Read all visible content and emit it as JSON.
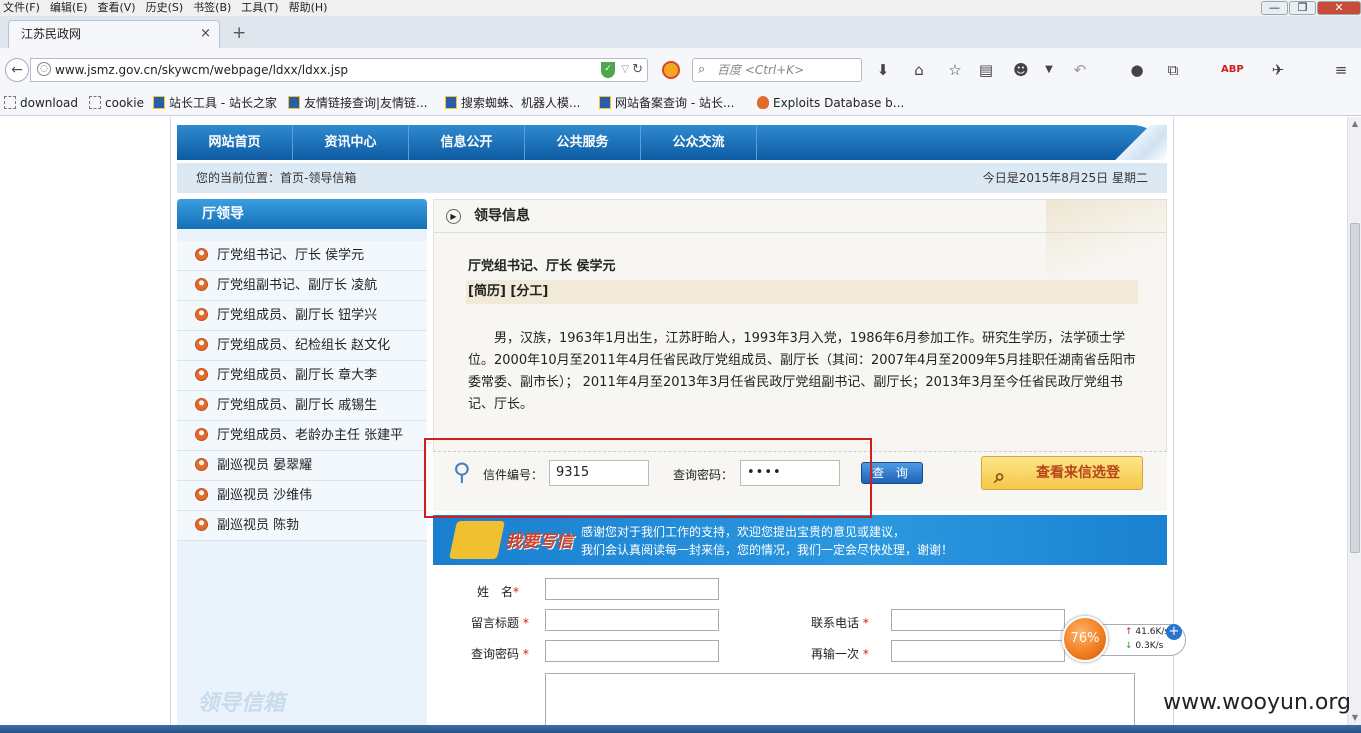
{
  "menubar": {
    "items": [
      "文件(F)",
      "编辑(E)",
      "查看(V)",
      "历史(S)",
      "书签(B)",
      "工具(T)",
      "帮助(H)"
    ]
  },
  "tab": {
    "title": "江苏民政网",
    "close": "×",
    "new": "+"
  },
  "address_bar": {
    "url": "www.jsmz.gov.cn/skywcm/webpage/ldxx/ldxx.jsp"
  },
  "search_box": {
    "placeholder": "百度 <Ctrl+K>"
  },
  "bookmarks": [
    {
      "label": "download",
      "icon": "folder-icon"
    },
    {
      "label": "cookie",
      "icon": "folder-icon"
    },
    {
      "label": "站长工具 - 站长之家",
      "icon": "page-icon"
    },
    {
      "label": "友情链接查询|友情链...",
      "icon": "page-icon"
    },
    {
      "label": "搜索蜘蛛、机器人模...",
      "icon": "page-icon"
    },
    {
      "label": "网站备案查询 - 站长...",
      "icon": "page-icon"
    },
    {
      "label": "Exploits Database b...",
      "icon": "bug-icon"
    }
  ],
  "site_nav": [
    "网站首页",
    "资讯中心",
    "信息公开",
    "公共服务",
    "公众交流"
  ],
  "breadcrumb": "您的当前位置：首页-领导信箱",
  "today": "今日是2015年8月25日 星期二",
  "sidebar": {
    "title": "厅领导",
    "items": [
      "厅党组书记、厅长 侯学元",
      "厅党组副书记、副厅长 凌航",
      "厅党组成员、副厅长 钮学兴",
      "厅党组成员、纪检组长 赵文化",
      "厅党组成员、副厅长 章大李",
      "厅党组成员、副厅长 戚锡生",
      "厅党组成员、老龄办主任 张建平",
      "副巡视员 晏翠耀",
      "副巡视员 沙维伟",
      "副巡视员 陈勃"
    ],
    "watermark": "领导信箱"
  },
  "main": {
    "heading": "领导信息",
    "leader_name": "厅党组书记、厅长 侯学元",
    "tabs": "[简历] [分工]",
    "bio": "男，汉族，1963年1月出生，江苏盱眙人，1993年3月入党，1986年6月参加工作。研究生学历，法学硕士学位。2000年10月至2011年4月任省民政厅党组成员、副厅长（其间：2007年4月至2009年5月挂职任湖南省岳阳市委常委、副市长）； 2011年4月至2013年3月任省民政厅党组副书记、副厅长；2013年3月至今任省民政厅党组书记、厅长。"
  },
  "query": {
    "letter_no_label": "信件编号：",
    "letter_no_value": "9315",
    "password_label": "查询密码：",
    "password_value": "••••",
    "query_button": "查 询",
    "view_button": "查看来信选登"
  },
  "write_banner": {
    "title": "我要写信",
    "line1": "感谢您对于我们工作的支持，欢迎您提出宝贵的意见或建议，",
    "line2": "我们会认真阅读每一封来信，您的情况，我们一定会尽快处理，谢谢！"
  },
  "form": {
    "name_label": "姓　名",
    "subject_label": "留言标题",
    "phone_label": "联系电话",
    "query_pwd_label": "查询密码",
    "repeat_label": "再输一次",
    "required_mark": "*"
  },
  "net_meter": {
    "percent": "76%",
    "up": "41.6K/s",
    "down": "0.3K/s"
  },
  "watermark": "www.wooyun.org",
  "colors": {
    "nav_blue": "#0d5ba2",
    "highlight_red": "#d21e1e",
    "banner_blue": "#1a7fcf"
  }
}
